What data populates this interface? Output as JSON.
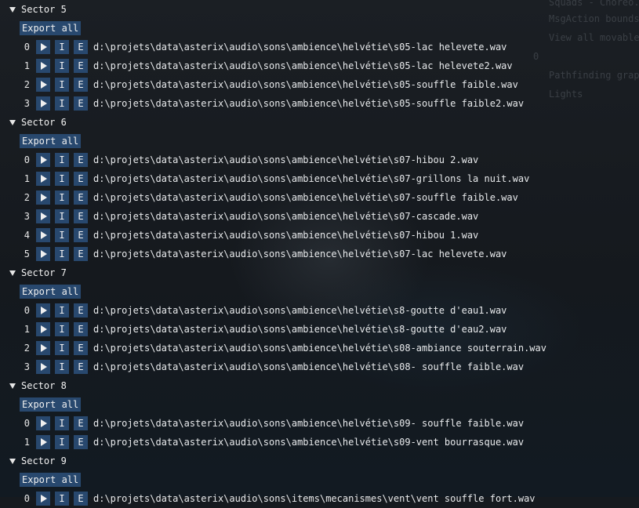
{
  "background_overlay": [
    "Squads - Choreo...",
    "MsgAction bounds",
    "View all movable",
    "0",
    "Pathfinding graph",
    "Lights"
  ],
  "icons": {
    "collapse": "triangle-down-icon",
    "play": "play-icon"
  },
  "colors": {
    "button_bg": "#28486e",
    "background": "#161a1f",
    "text": "#e8eaec"
  },
  "sectors": [
    {
      "title": "Sector 5",
      "export_label": "Export all",
      "files": [
        {
          "index": "0",
          "import_label": "I",
          "export_label": "E",
          "path": "d:\\projets\\data\\asterix\\audio\\sons\\ambience\\helvétie\\s05-lac helevete.wav"
        },
        {
          "index": "1",
          "import_label": "I",
          "export_label": "E",
          "path": "d:\\projets\\data\\asterix\\audio\\sons\\ambience\\helvétie\\s05-lac helevete2.wav"
        },
        {
          "index": "2",
          "import_label": "I",
          "export_label": "E",
          "path": "d:\\projets\\data\\asterix\\audio\\sons\\ambience\\helvétie\\s05-souffle faible.wav"
        },
        {
          "index": "3",
          "import_label": "I",
          "export_label": "E",
          "path": "d:\\projets\\data\\asterix\\audio\\sons\\ambience\\helvétie\\s05-souffle faible2.wav"
        }
      ]
    },
    {
      "title": "Sector 6",
      "export_label": "Export all",
      "files": [
        {
          "index": "0",
          "import_label": "I",
          "export_label": "E",
          "path": "d:\\projets\\data\\asterix\\audio\\sons\\ambience\\helvétie\\s07-hibou 2.wav"
        },
        {
          "index": "1",
          "import_label": "I",
          "export_label": "E",
          "path": "d:\\projets\\data\\asterix\\audio\\sons\\ambience\\helvétie\\s07-grillons la nuit.wav"
        },
        {
          "index": "2",
          "import_label": "I",
          "export_label": "E",
          "path": "d:\\projets\\data\\asterix\\audio\\sons\\ambience\\helvétie\\s07-souffle faible.wav"
        },
        {
          "index": "3",
          "import_label": "I",
          "export_label": "E",
          "path": "d:\\projets\\data\\asterix\\audio\\sons\\ambience\\helvétie\\s07-cascade.wav"
        },
        {
          "index": "4",
          "import_label": "I",
          "export_label": "E",
          "path": "d:\\projets\\data\\asterix\\audio\\sons\\ambience\\helvétie\\s07-hibou 1.wav"
        },
        {
          "index": "5",
          "import_label": "I",
          "export_label": "E",
          "path": "d:\\projets\\data\\asterix\\audio\\sons\\ambience\\helvétie\\s07-lac helevete.wav"
        }
      ]
    },
    {
      "title": "Sector 7",
      "export_label": "Export all",
      "files": [
        {
          "index": "0",
          "import_label": "I",
          "export_label": "E",
          "path": "d:\\projets\\data\\asterix\\audio\\sons\\ambience\\helvétie\\s8-goutte d'eau1.wav"
        },
        {
          "index": "1",
          "import_label": "I",
          "export_label": "E",
          "path": "d:\\projets\\data\\asterix\\audio\\sons\\ambience\\helvétie\\s8-goutte d'eau2.wav"
        },
        {
          "index": "2",
          "import_label": "I",
          "export_label": "E",
          "path": "d:\\projets\\data\\asterix\\audio\\sons\\ambience\\helvétie\\s08-ambiance souterrain.wav"
        },
        {
          "index": "3",
          "import_label": "I",
          "export_label": "E",
          "path": "d:\\projets\\data\\asterix\\audio\\sons\\ambience\\helvétie\\s08- souffle faible.wav"
        }
      ]
    },
    {
      "title": "Sector 8",
      "export_label": "Export all",
      "files": [
        {
          "index": "0",
          "import_label": "I",
          "export_label": "E",
          "path": "d:\\projets\\data\\asterix\\audio\\sons\\ambience\\helvétie\\s09- souffle faible.wav"
        },
        {
          "index": "1",
          "import_label": "I",
          "export_label": "E",
          "path": "d:\\projets\\data\\asterix\\audio\\sons\\ambience\\helvétie\\s09-vent bourrasque.wav"
        }
      ]
    },
    {
      "title": "Sector 9",
      "export_label": "Export all",
      "files": [
        {
          "index": "0",
          "import_label": "I",
          "export_label": "E",
          "path": "d:\\projets\\data\\asterix\\audio\\sons\\items\\mecanismes\\vent\\vent souffle fort.wav"
        }
      ]
    }
  ]
}
